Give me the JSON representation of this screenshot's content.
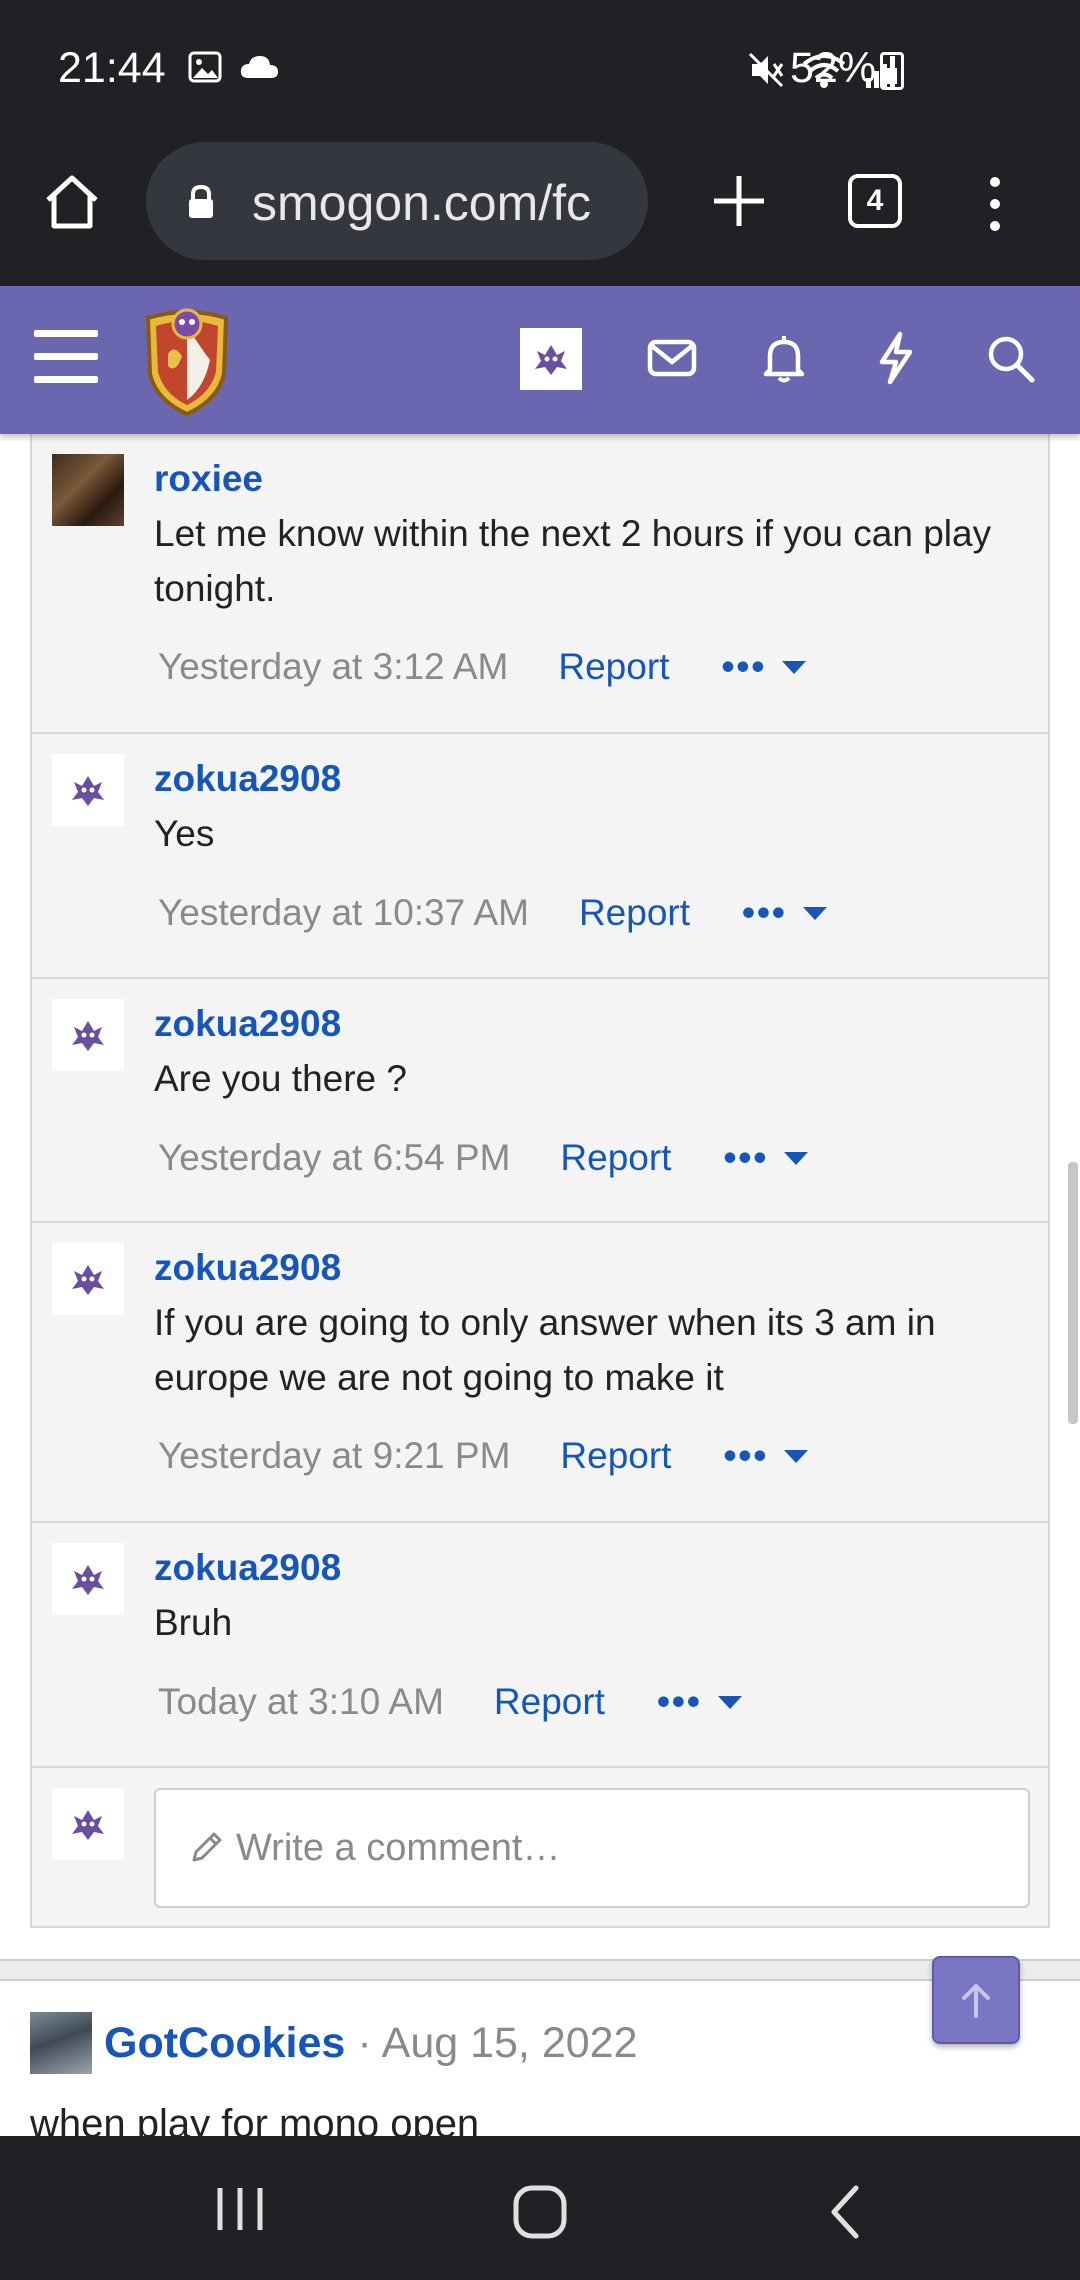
{
  "status_bar": {
    "time": "21:44",
    "battery": "52%",
    "icons": [
      "image-icon",
      "cloud-icon",
      "mute-icon",
      "wifi-icon",
      "signal-icon",
      "battery-icon"
    ]
  },
  "browser": {
    "url": "smogon.com/fc",
    "tab_count": "4"
  },
  "site_header": {
    "icons": [
      "menu-icon",
      "smogon-logo",
      "user-avatar",
      "mail-icon",
      "bell-icon",
      "bolt-icon",
      "search-icon"
    ],
    "colors": {
      "bar": "#6b66b0"
    }
  },
  "comments": [
    {
      "user": "roxiee",
      "text": "Let me know within the next 2 hours if you can play tonight.",
      "time": "Yesterday at 3:12 AM",
      "report": "Report",
      "more": "•••"
    },
    {
      "user": "zokua2908",
      "text": "Yes",
      "time": "Yesterday at 10:37 AM",
      "report": "Report",
      "more": "•••"
    },
    {
      "user": "zokua2908",
      "text": "Are you there ?",
      "time": "Yesterday at 6:54 PM",
      "report": "Report",
      "more": "•••"
    },
    {
      "user": "zokua2908",
      "text": "If you are going to only answer when its 3 am in europe we are not going to make it",
      "time": "Yesterday at 9:21 PM",
      "report": "Report",
      "more": "•••"
    },
    {
      "user": "zokua2908",
      "text": "Bruh",
      "time": "Today at 3:10 AM",
      "report": "Report",
      "more": "•••"
    }
  ],
  "comment_input": {
    "placeholder": "Write a comment…"
  },
  "next_post": {
    "user": "GotCookies",
    "separator": "·",
    "date": "Aug 15, 2022",
    "text": "when play for mono open"
  },
  "colors": {
    "link": "#1656b8",
    "meta": "#8a8a8a"
  }
}
